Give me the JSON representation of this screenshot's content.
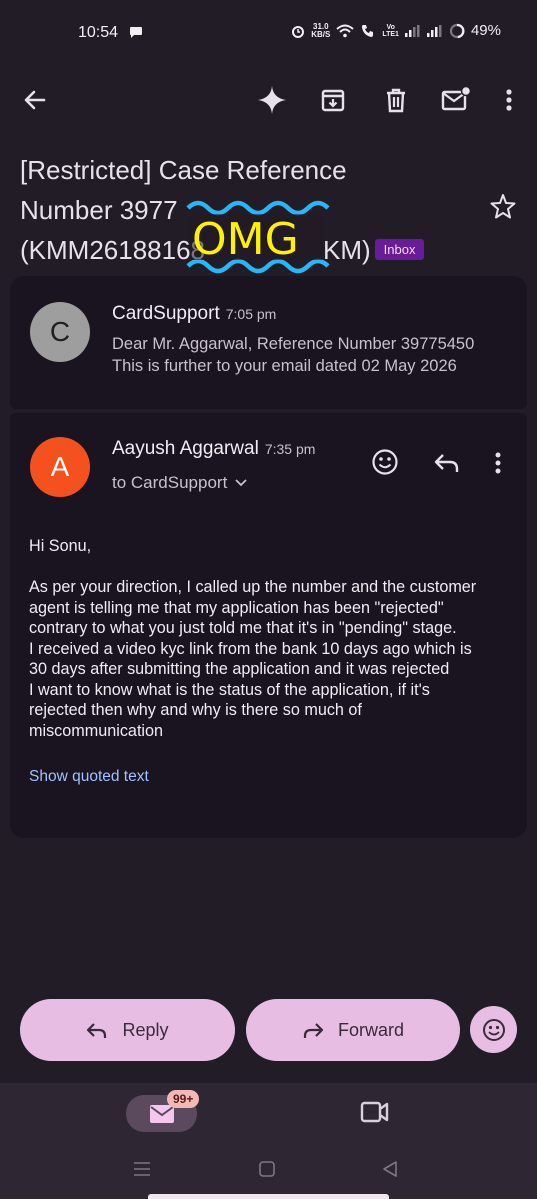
{
  "status_bar": {
    "time": "10:54",
    "net_speed_value": "31.0",
    "net_speed_unit": "KB/S",
    "volte_top": "Vo",
    "volte_bottom": "LTE1",
    "battery": "49%"
  },
  "subject": {
    "line": "[Restricted] Case Reference Number 3977●●●● (KMM261881●●●●●●●●●●KM)",
    "part1": "[Restricted] Case Reference",
    "part2": "Number 3977",
    "part3": "(KMM26188168",
    "part4": "KM)",
    "label": "Inbox",
    "overlay_text": "OMG"
  },
  "messages": [
    {
      "avatar_letter": "C",
      "sender": "CardSupport",
      "time": "7:05 pm",
      "snippet_line1": "Dear Mr. Aggarwal, Reference Number 39775450",
      "snippet_line2": "This is further to your email dated 02 May 2026"
    },
    {
      "avatar_letter": "A",
      "sender": "Aayush Aggarwal",
      "time": "7:35 pm",
      "to": "to CardSupport",
      "greeting": "Hi Sonu,",
      "body": "As per your direction, I called up the number and the customer\nagent is telling me that my application has been \"rejected\"\ncontrary to what you just told me that it's in \"pending\" stage.\nI received a video kyc link from the bank 10 days ago which is\n30 days after submitting the application and it was rejected\nI want to know what is the status of the application, if it's\nrejected then why and why is there so much of\nmiscommunication",
      "show_quoted": "Show quoted text"
    }
  ],
  "actions": {
    "reply": "Reply",
    "forward": "Forward"
  },
  "bottom_nav": {
    "mail_badge": "99+"
  },
  "colors": {
    "background": "#221c27",
    "card": "#1a1320",
    "pill": "#e8bde4",
    "label_badge": "#6a1b9a",
    "avatar_a": "#f4511e",
    "avatar_c": "#9e9e9e",
    "link": "#9fc3ff",
    "overlay": "#fff200",
    "squiggle": "#29b6f6"
  }
}
